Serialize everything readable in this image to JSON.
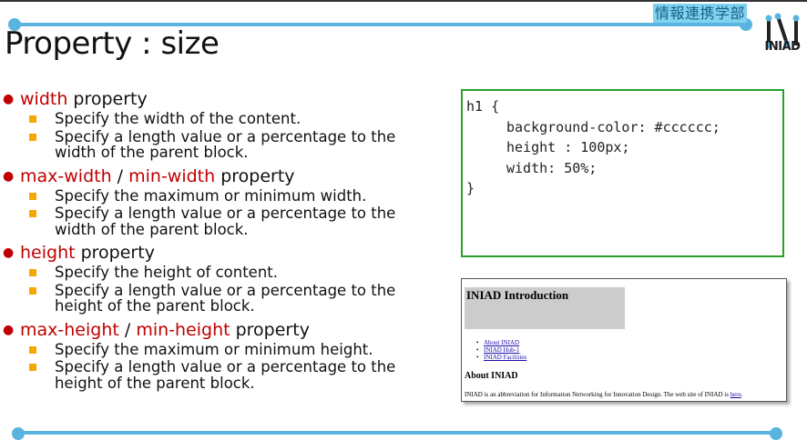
{
  "header": {
    "faculty_label": "情報連携学部",
    "logo_text": "INIAD",
    "title": "Property : size"
  },
  "colors": {
    "accent_blue": "#5ab4e0",
    "property_red": "#c00000",
    "sub_bullet_orange": "#f7a800",
    "code_border_green": "#2aa02a",
    "preview_h1_bg": "#cccccc"
  },
  "bullets": [
    {
      "parts": [
        {
          "text": "width",
          "red": true
        },
        {
          "text": " property",
          "red": false
        }
      ],
      "subs": [
        "Specify the width of the content.",
        "Specify a length value or a percentage to the width of the parent block."
      ]
    },
    {
      "parts": [
        {
          "text": "max-width",
          "red": true
        },
        {
          "text": " / ",
          "red": false
        },
        {
          "text": "min-width",
          "red": true
        },
        {
          "text": " property",
          "red": false
        }
      ],
      "subs": [
        "Specify the maximum or minimum width.",
        "Specify a length value or a percentage to the width of the parent block."
      ]
    },
    {
      "parts": [
        {
          "text": "height",
          "red": true
        },
        {
          "text": " property",
          "red": false
        }
      ],
      "subs": [
        "Specify the height of content.",
        "Specify a length value or a percentage to the height of the parent block."
      ]
    },
    {
      "parts": [
        {
          "text": "max-height",
          "red": true
        },
        {
          "text": " / ",
          "red": false
        },
        {
          "text": "min-height",
          "red": true
        },
        {
          "text": " property",
          "red": false
        }
      ],
      "subs": [
        "Specify the maximum or minimum height.",
        "Specify a length value or a percentage to the height of the parent block."
      ]
    }
  ],
  "code": {
    "lines": [
      "h1 {",
      "background-color: #cccccc;",
      "height : 100px;",
      "width: 50%;",
      "}"
    ]
  },
  "preview": {
    "h1": "INIAD Introduction",
    "links": [
      "About INIAD",
      "INIAD Hub-1",
      "INIAD Facilities"
    ],
    "h2": "About INIAD",
    "paragraph": "INIAD is an abbreviation for Information Networking for Innovation Design. The web site of INIAD is ",
    "paragraph_link": "here",
    "paragraph_end": "."
  }
}
